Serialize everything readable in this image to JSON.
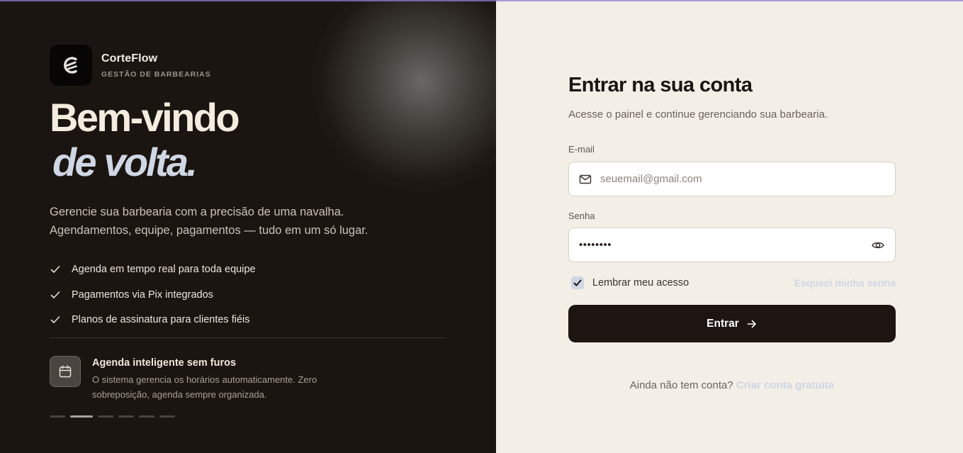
{
  "brand": {
    "name": "CorteFlow",
    "tagline": "GESTÃO DE BARBEARIAS",
    "logo_icon": "corteflow-logo-icon"
  },
  "hero": {
    "line1": "Bem-vindo",
    "line2": "de volta."
  },
  "description": {
    "line1": "Gerencie sua barbearia com a precisão de uma navalha.",
    "line2": "Agendamentos, equipe, pagamentos — tudo em um só lugar."
  },
  "features": [
    "Agenda em tempo real para toda equipe",
    "Pagamentos via Pix integrados",
    "Planos de assinatura para clientes fiéis"
  ],
  "highlight": {
    "icon": "calendar-icon",
    "title": "Agenda inteligente sem furos",
    "text_line1": "O sistema gerencia os horários automaticamente. Zero",
    "text_line2": "sobreposição, agenda sempre organizada."
  },
  "carousel": {
    "count": 6,
    "active_index": 1
  },
  "form": {
    "title": "Entrar na sua conta",
    "subtitle": "Acesse o painel e continue gerenciando sua barbearia.",
    "email_label": "E-mail",
    "email_placeholder": "seuemail@gmail.com",
    "password_label": "Senha",
    "password_value": "••••••••",
    "remember_label": "Lembrar meu acesso",
    "remember_checked": true,
    "forgot_link": "Esqueci minha senha",
    "submit_label": "Entrar",
    "signup_prompt": "Ainda não tem conta?",
    "signup_link": "Criar conta gratuita"
  },
  "colors": {
    "left_bg": "#1b1511",
    "right_bg": "#f3efe7",
    "accent": "#cfd6e4",
    "button_bg": "#1c1511"
  }
}
